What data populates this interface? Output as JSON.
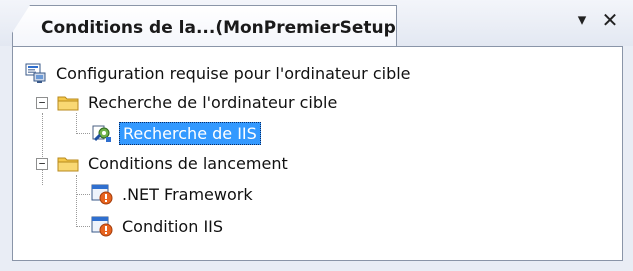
{
  "window": {
    "tab_title": "Conditions de la...(MonPremierSetup)",
    "pin_glyph": "▾",
    "close_glyph": "✕"
  },
  "tree": {
    "root": {
      "label": "Configuration requise pour l'ordinateur cible",
      "icon": "computer-requirements-icon"
    },
    "search": {
      "label": "Recherche de l'ordinateur cible",
      "icon": "folder-icon",
      "expander": "−",
      "children": [
        {
          "label": "Recherche de IIS",
          "icon": "search-gear-icon",
          "selected": true
        }
      ]
    },
    "launch": {
      "label": "Conditions de lancement",
      "icon": "folder-icon",
      "expander": "−",
      "children": [
        {
          "label": ".NET Framework",
          "icon": "launch-condition-icon"
        },
        {
          "label": "Condition IIS",
          "icon": "launch-condition-icon"
        }
      ]
    }
  },
  "colors": {
    "selection": "#3399ff",
    "folder": "#f5c84a",
    "accent": "#2f6fcf"
  }
}
